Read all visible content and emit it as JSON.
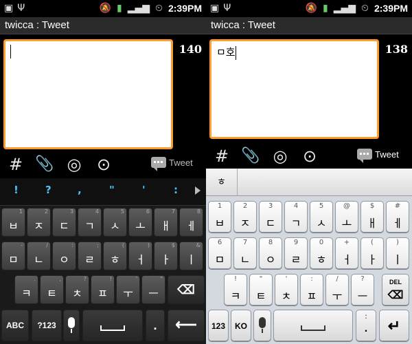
{
  "status_bar": {
    "time": "2:39PM"
  },
  "app": {
    "title": "twicca : Tweet"
  },
  "screens": [
    {
      "counter": "140",
      "text": ""
    },
    {
      "counter": "138",
      "text": "ㅁ호"
    }
  ],
  "toolbar": {
    "hash": "#",
    "tweet_label": "Tweet"
  },
  "left_keyboard": {
    "suggestions": [
      "!",
      "?",
      ",",
      "\"",
      "'",
      ":"
    ],
    "row1": [
      {
        "k": "ㅂ",
        "s": "1"
      },
      {
        "k": "ㅈ",
        "s": "2"
      },
      {
        "k": "ㄷ",
        "s": "3"
      },
      {
        "k": "ㄱ",
        "s": "4"
      },
      {
        "k": "ㅅ",
        "s": "5"
      },
      {
        "k": "ㅗ",
        "s": "6"
      },
      {
        "k": "ㅐ",
        "s": "7"
      },
      {
        "k": "ㅔ",
        "s": "8"
      }
    ],
    "row2": [
      {
        "k": "ㅁ",
        "s": "-"
      },
      {
        "k": "ㄴ",
        "s": "/"
      },
      {
        "k": "ㅇ",
        "s": ":"
      },
      {
        "k": "ㄹ",
        "s": ";"
      },
      {
        "k": "ㅎ",
        "s": "("
      },
      {
        "k": "ㅓ",
        "s": ")"
      },
      {
        "k": "ㅏ",
        "s": "$"
      },
      {
        "k": "ㅣ",
        "s": "&"
      }
    ],
    "row3": [
      {
        "k": "ㅋ",
        "s": "."
      },
      {
        "k": "ㅌ",
        "s": ","
      },
      {
        "k": "ㅊ",
        "s": "?"
      },
      {
        "k": "ㅍ",
        "s": "!"
      },
      {
        "k": "ㅜ",
        "s": "'"
      },
      {
        "k": "ㅡ",
        "s": "\""
      }
    ],
    "abc": "ABC",
    "num": "?123",
    "period": "."
  },
  "right_keyboard": {
    "suggestion": "ㅎ",
    "row1": [
      {
        "k": "ㅂ",
        "s": "1"
      },
      {
        "k": "ㅈ",
        "s": "2"
      },
      {
        "k": "ㄷ",
        "s": "3"
      },
      {
        "k": "ㄱ",
        "s": "4"
      },
      {
        "k": "ㅅ",
        "s": "5"
      },
      {
        "k": "ㅗ",
        "s": "@"
      },
      {
        "k": "ㅐ",
        "s": "$"
      },
      {
        "k": "ㅔ",
        "s": "#"
      }
    ],
    "row2": [
      {
        "k": "ㅁ",
        "s": "6"
      },
      {
        "k": "ㄴ",
        "s": "7"
      },
      {
        "k": "ㅇ",
        "s": "8"
      },
      {
        "k": "ㄹ",
        "s": "9"
      },
      {
        "k": "ㅎ",
        "s": "0"
      },
      {
        "k": "ㅓ",
        "s": "+"
      },
      {
        "k": "ㅏ",
        "s": "("
      },
      {
        "k": "ㅣ",
        "s": ")"
      }
    ],
    "row3": [
      {
        "k": "ㅋ",
        "s": "!"
      },
      {
        "k": "ㅌ",
        "s": "\""
      },
      {
        "k": "ㅊ",
        "s": "'"
      },
      {
        "k": "ㅍ",
        "s": ":"
      },
      {
        "k": "ㅜ",
        "s": "/"
      },
      {
        "k": "ㅡ",
        "s": "?"
      }
    ],
    "del": "DEL",
    "num": "123",
    "ko": "KO",
    "colon": ":",
    "period": "."
  }
}
